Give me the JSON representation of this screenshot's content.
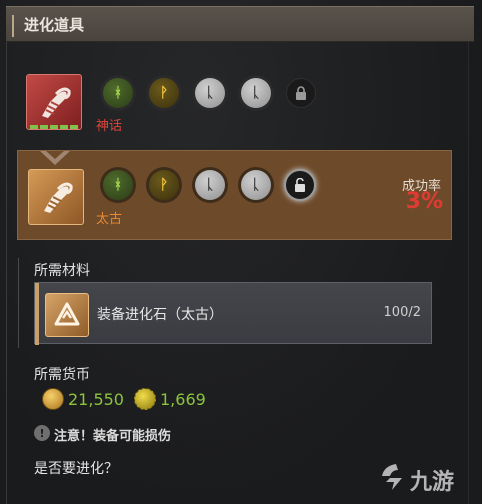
{
  "header": {
    "title": "进化道具"
  },
  "items": [
    {
      "grade": "神话",
      "runes": [
        {
          "glyph": "ᚼ",
          "color": "green"
        },
        {
          "glyph": "ᚹ",
          "color": "yellow"
        },
        {
          "glyph": "ᚳ",
          "color": "white"
        },
        {
          "glyph": "ᚳ",
          "color": "white"
        },
        {
          "glyph": "🔒",
          "color": "locked"
        }
      ]
    },
    {
      "grade": "太古",
      "runes": [
        {
          "glyph": "ᚼ",
          "color": "green"
        },
        {
          "glyph": "ᚹ",
          "color": "yellow"
        },
        {
          "glyph": "ᚳ",
          "color": "white"
        },
        {
          "glyph": "ᚳ",
          "color": "white"
        },
        {
          "glyph": "🔓",
          "color": "open"
        }
      ],
      "success_label": "成功率",
      "success_value": "3%"
    }
  ],
  "materials": {
    "title": "所需材料",
    "items": [
      {
        "name": "装备进化石（太古）",
        "count": "100/2"
      }
    ]
  },
  "currency": {
    "title": "所需货币",
    "gold": "21,550",
    "gear": "1,669"
  },
  "warning": {
    "icon": "!",
    "text": "注意！装备可能损伤"
  },
  "question": "是否要进化？",
  "colors": {
    "mythic": "#e0443c",
    "ancient": "#e98a32",
    "success": "#e03b32",
    "currency": "#8cc43e",
    "ancient_row_bg": "#6d4a2a"
  }
}
